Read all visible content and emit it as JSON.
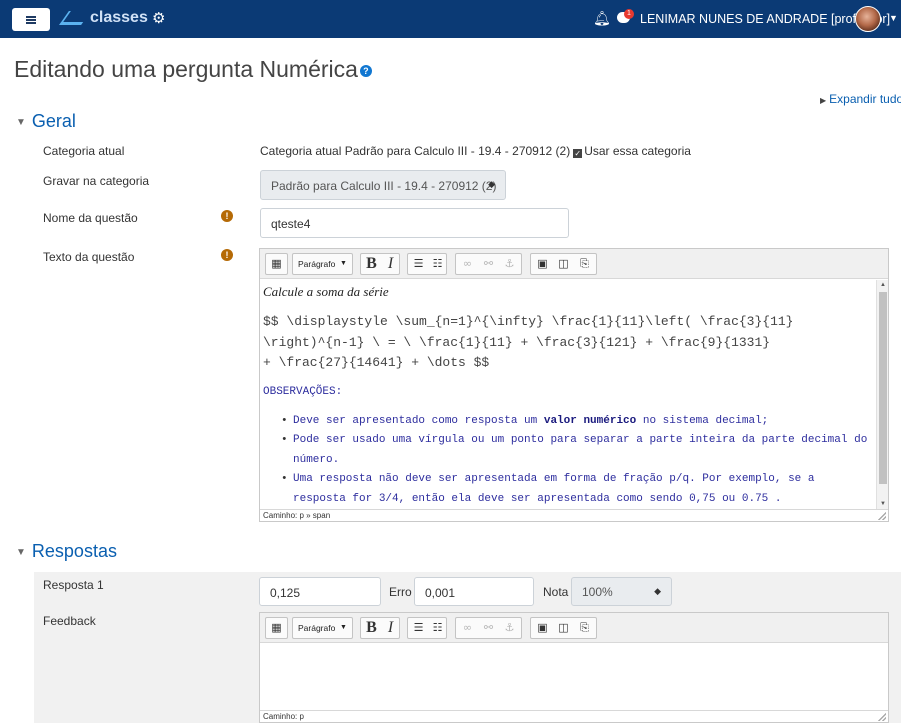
{
  "navbar": {
    "brand": "classes",
    "user_name": "LENIMAR NUNES DE ANDRADE [professor]",
    "message_count": "1"
  },
  "page": {
    "title": "Editando uma pergunta Numérica",
    "help": "?",
    "expand_all": "Expandir tudo"
  },
  "geral": {
    "heading": "Geral",
    "categoria_atual_label": "Categoria atual",
    "categoria_atual_value": "Categoria atual  Padrão para Calculo III - 19.4 - 270912 (2)",
    "usar_categoria_label": "Usar essa categoria",
    "gravar_label": "Gravar na categoria",
    "gravar_value": "Padrão para Calculo III - 19.4 - 270912 (2)",
    "nome_label": "Nome da questão",
    "nome_value": "qteste4",
    "texto_label": "Texto da questão",
    "required_mark": "!"
  },
  "editor1": {
    "format": "Parágrafo",
    "line1": "Calcule a soma da série",
    "tex_line1": "$$ \\displaystyle \\sum_{n=1}^{\\infty} \\frac{1}{11}\\left( \\frac{3}{11}",
    "tex_line2": "\\right)^{n-1} \\ = \\ \\frac{1}{11} +  \\frac{3}{121} +  \\frac{9}{1331}",
    "tex_line3": "+  \\frac{27}{14641} + \\dots $$",
    "obs_heading": "OBSERVAÇÕES:",
    "obs1_before": "Deve ser apresentado como resposta um ",
    "obs1_bold": "valor numérico",
    "obs1_after": " no sistema decimal;",
    "obs2": "Pode ser usado uma vírgula ou um ponto para separar a parte inteira da parte decimal do número.",
    "obs3": "Uma resposta não deve ser apresentada em forma de fração p/q. Por exemplo, se a resposta for 3/4, então ela deve ser apresentada como sendo 0,75 ou 0.75 .",
    "path": "Caminho: p » span"
  },
  "respostas": {
    "heading": "Respostas",
    "resposta1_label": "Resposta 1",
    "resposta1_value": "0,125",
    "erro_label": "Erro",
    "erro_value": "0,001",
    "nota_label": "Nota",
    "nota_value": "100%",
    "feedback_label": "Feedback"
  },
  "editor2": {
    "format": "Parágrafo",
    "path": "Caminho: p"
  },
  "icons": [
    "menu-icon",
    "gear-icon",
    "bell-icon",
    "chat-icon",
    "help-icon",
    "warning-icon"
  ],
  "colors": {
    "navbar": "#0b3a75",
    "link": "#0a5fb0",
    "required": "#b56a06"
  }
}
